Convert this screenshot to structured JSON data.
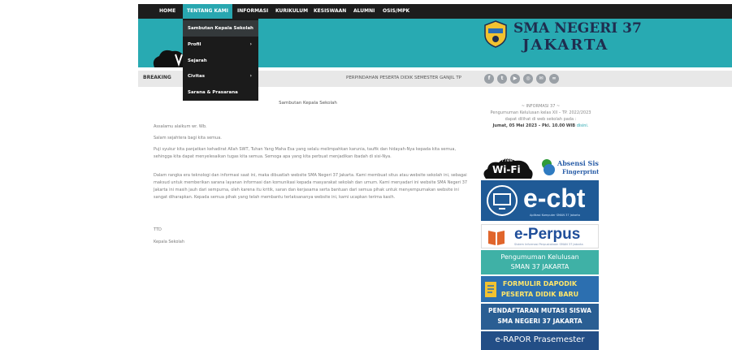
{
  "nav": {
    "items": [
      "HOME",
      "TENTANG KAMI",
      "INFORMASI",
      "KURIKULUM",
      "KESISWAAN",
      "ALUMNI",
      "OSIS/MPK"
    ],
    "active": "TENTANG KAMI"
  },
  "dropdown": {
    "items": [
      {
        "label": "Sambutan Kepala Sekolah",
        "submenu": false
      },
      {
        "label": "Profil",
        "submenu": true
      },
      {
        "label": "Sejarah",
        "submenu": false
      },
      {
        "label": "Civitas",
        "submenu": true
      },
      {
        "label": "Sarana & Prasarana",
        "submenu": false
      }
    ],
    "arrow": "›"
  },
  "brand": {
    "line1": "SMA NEGERI 37",
    "line2": "JAKARTA",
    "emblem_text": "SMA"
  },
  "breaking": {
    "label": "BREAKING",
    "ticker": "PERPINDAHAN PESERTA DIDIK SEMESTER GANJIL TP"
  },
  "social_icons": [
    "facebook-icon",
    "twitter-icon",
    "youtube-icon",
    "instagram-icon",
    "mail-icon",
    "link-icon"
  ],
  "content": {
    "title": "Sambutan Kepala Sekolah",
    "salam1": "Assalamu alaikum wr. Wb.",
    "salam2": "Salam sejahtera bagi kita semua.",
    "para1": "Puji syukur kita panjatkan kehadirat Allah SWT, Tuhan Yang Maha Esa yang selalu melimpahkan karunia, taufik dan hidayah-Nya kepada kita semua, sehingga kita dapat menyelesaikan tugas kita semua. Semoga apa yang kita perbuat menjadikan ibadah di sisi-Nya.",
    "para2": "Dalam rangka era teknologi dan informasi saat ini, maka dibuatlah website SMA Negeri 37 Jakarta. Kami membuat situs atau website sekolah ini, sebagai maksud untuk memberikan sarana layanan informasi dan komunikasi kepada masyarakat sekolah dan umum. Kami menyadari ini website SMA Negeri 37 Jakarta ini masih jauh dari sempurna, oleh karena itu kritik, saran dan kerjasama serta bantuan dari semua pihak untuk menyempurnakan website ini sangat diharapkan. Kepada semua pihak yang telah membantu terlaksananya website ini, kami ucapkan terima kasih.",
    "ttd": "TTD",
    "kepala": "Kepala Sekolah"
  },
  "sidebar_info": {
    "heading": "~ INFORMASI 37 ~",
    "line1": "Pengumuman Kelulusan kelas XII – TP. 2022/2023",
    "line2": "dapat dilihat di web sekolah pada :",
    "date": "Jumat, 05 Mei 2023 – Pkl. 10.00 WIB",
    "link": "disini."
  },
  "banners": {
    "wifi": "Wi-Fi",
    "wifi_small": "Free",
    "absensi1": "Absensi Siswa",
    "absensi2": "Fingerprint",
    "ecbt": "e-cbt",
    "ecbt_sub": "Aplikasi Komputer SMAN 37 Jakarta",
    "perpus": "e-Perpus",
    "perpus_sub": "Sistem Informasi Perpustakaan SMAN 37 Jakarta",
    "lulus1": "Pengumuman Kelulusan",
    "lulus2": "SMAN 37 JAKARTA",
    "dapodik1": "FORMULIR DAPODIK",
    "dapodik2": "PESERTA DIDIK BARU",
    "mutasi1": "PENDAFTARAN MUTASI SISWA",
    "mutasi2": "SMA NEGERI 37 JAKARTA",
    "rapor": "e-RAPOR Prasemester"
  },
  "colors": {
    "teal": "#28aab2",
    "nav": "#1d1d1d",
    "navy": "#1f2d4f"
  }
}
